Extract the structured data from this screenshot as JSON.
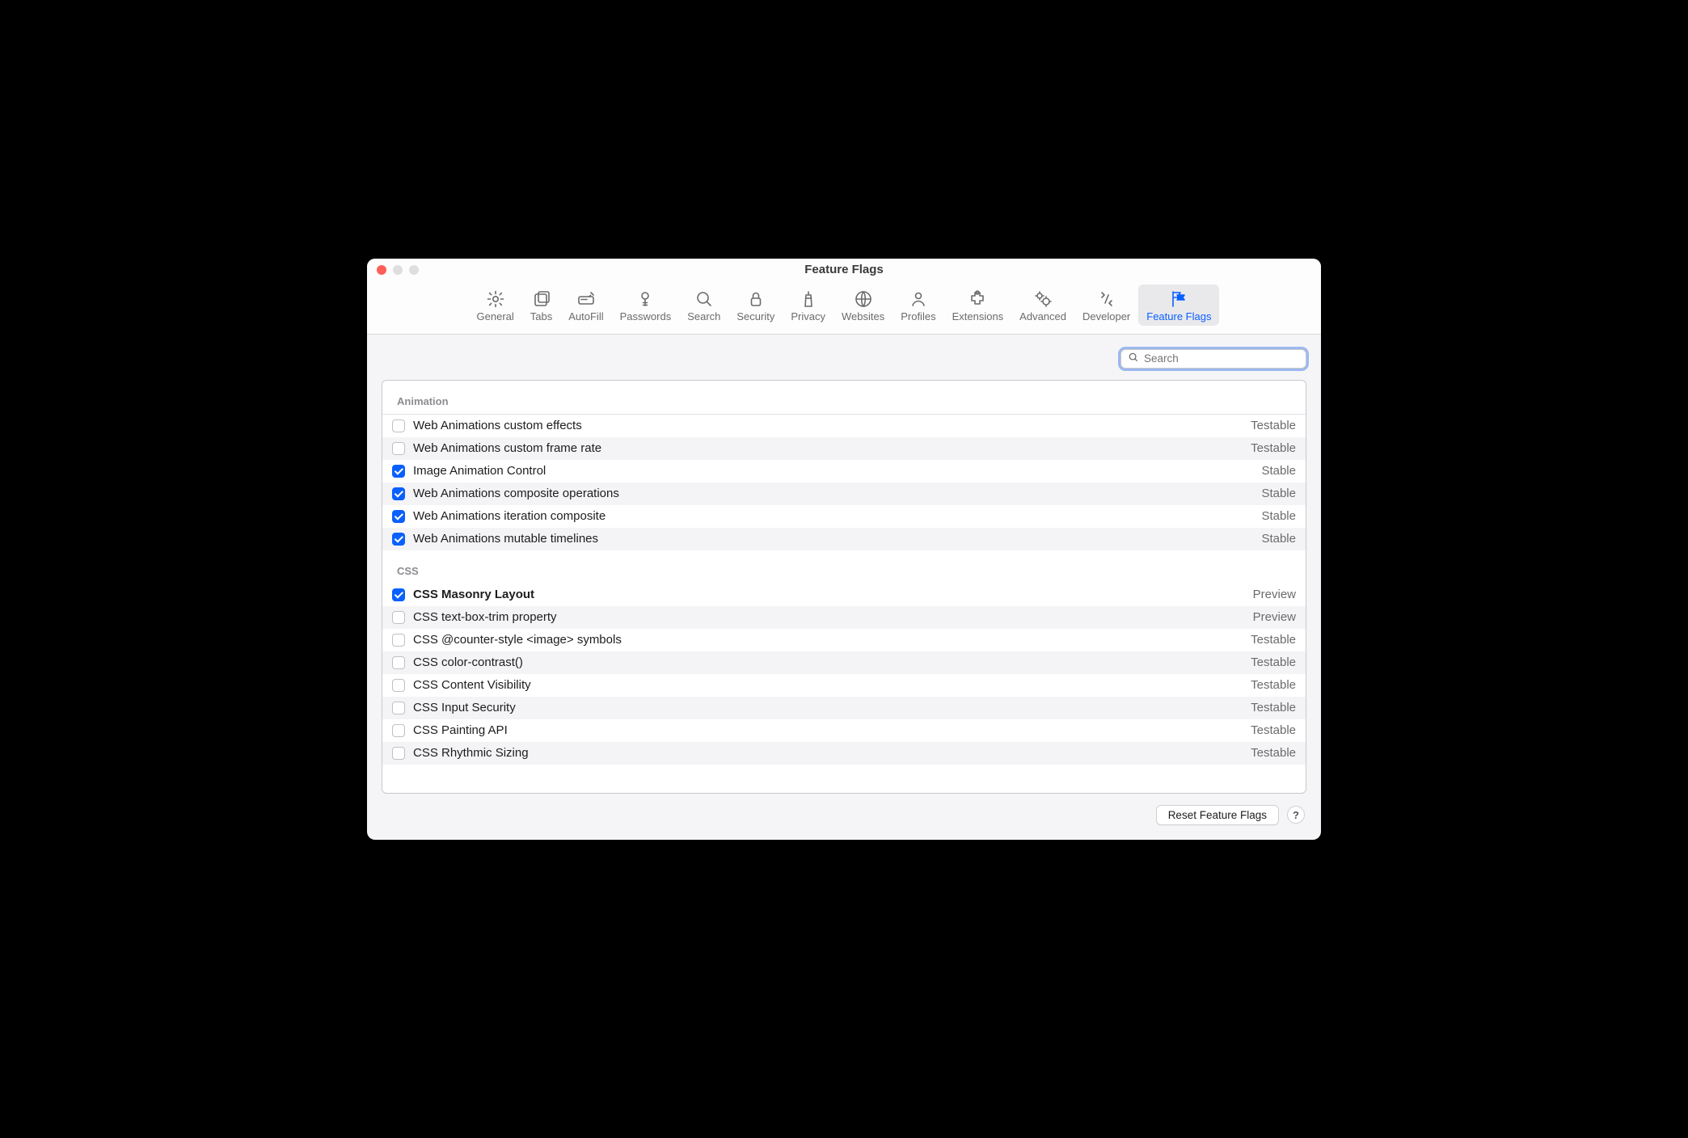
{
  "window": {
    "title": "Feature Flags"
  },
  "toolbar": {
    "tabs": [
      {
        "id": "general",
        "label": "General"
      },
      {
        "id": "tabs",
        "label": "Tabs"
      },
      {
        "id": "autofill",
        "label": "AutoFill"
      },
      {
        "id": "passwords",
        "label": "Passwords"
      },
      {
        "id": "search",
        "label": "Search"
      },
      {
        "id": "security",
        "label": "Security"
      },
      {
        "id": "privacy",
        "label": "Privacy"
      },
      {
        "id": "websites",
        "label": "Websites"
      },
      {
        "id": "profiles",
        "label": "Profiles"
      },
      {
        "id": "extensions",
        "label": "Extensions"
      },
      {
        "id": "advanced",
        "label": "Advanced"
      },
      {
        "id": "developer",
        "label": "Developer"
      },
      {
        "id": "feature-flags",
        "label": "Feature Flags"
      }
    ],
    "activeTab": "feature-flags"
  },
  "search": {
    "placeholder": "Search"
  },
  "sections": [
    {
      "title": "Animation",
      "rows": [
        {
          "checked": false,
          "label": "Web Animations custom effects",
          "status": "Testable",
          "modified": false
        },
        {
          "checked": false,
          "label": "Web Animations custom frame rate",
          "status": "Testable",
          "modified": false
        },
        {
          "checked": true,
          "label": "Image Animation Control",
          "status": "Stable",
          "modified": false
        },
        {
          "checked": true,
          "label": "Web Animations composite operations",
          "status": "Stable",
          "modified": false
        },
        {
          "checked": true,
          "label": "Web Animations iteration composite",
          "status": "Stable",
          "modified": false
        },
        {
          "checked": true,
          "label": "Web Animations mutable timelines",
          "status": "Stable",
          "modified": false
        }
      ]
    },
    {
      "title": "CSS",
      "rows": [
        {
          "checked": true,
          "label": "CSS Masonry Layout",
          "status": "Preview",
          "modified": true
        },
        {
          "checked": false,
          "label": "CSS text-box-trim property",
          "status": "Preview",
          "modified": false
        },
        {
          "checked": false,
          "label": "CSS @counter-style <image> symbols",
          "status": "Testable",
          "modified": false
        },
        {
          "checked": false,
          "label": "CSS color-contrast()",
          "status": "Testable",
          "modified": false
        },
        {
          "checked": false,
          "label": "CSS Content Visibility",
          "status": "Testable",
          "modified": false
        },
        {
          "checked": false,
          "label": "CSS Input Security",
          "status": "Testable",
          "modified": false
        },
        {
          "checked": false,
          "label": "CSS Painting API",
          "status": "Testable",
          "modified": false
        },
        {
          "checked": false,
          "label": "CSS Rhythmic Sizing",
          "status": "Testable",
          "modified": false
        }
      ]
    }
  ],
  "footer": {
    "reset_label": "Reset Feature Flags",
    "help_label": "?"
  }
}
